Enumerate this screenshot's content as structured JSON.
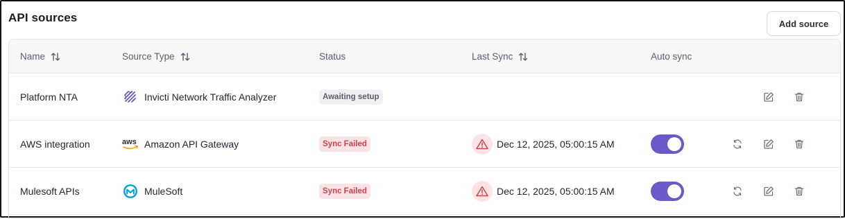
{
  "page": {
    "title": "API sources",
    "add_button": "Add source"
  },
  "table": {
    "headers": {
      "name": "Name",
      "source_type": "Source Type",
      "status": "Status",
      "last_sync": "Last Sync",
      "auto_sync": "Auto sync"
    },
    "rows": [
      {
        "name": "Platform NTA",
        "source_type": "Invicti Network Traffic Analyzer",
        "source_icon": "invicti-icon",
        "status": "Awaiting setup",
        "status_kind": "pending",
        "last_sync": "",
        "auto_sync": null
      },
      {
        "name": "AWS integration",
        "source_type": "Amazon API Gateway",
        "source_icon": "aws-icon",
        "aws_text": "aws",
        "status": "Sync Failed",
        "status_kind": "failed",
        "last_sync": "Dec 12, 2025, 05:00:15 AM",
        "auto_sync": true
      },
      {
        "name": "Mulesoft APIs",
        "source_type": "MuleSoft",
        "source_icon": "mulesoft-icon",
        "status": "Sync Failed",
        "status_kind": "failed",
        "last_sync": "Dec 12, 2025, 05:00:15 AM",
        "auto_sync": true
      }
    ]
  },
  "colors": {
    "accent": "#6a59c8",
    "failed_bg": "#fbe3e5",
    "failed_text": "#d0414f",
    "pending_bg": "#eef0f3"
  }
}
